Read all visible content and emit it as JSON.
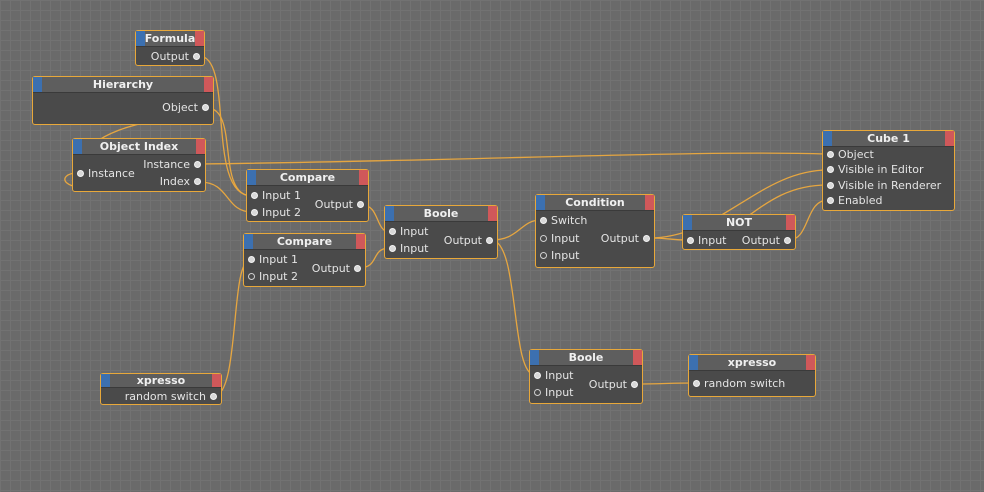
{
  "nodes": {
    "formula": {
      "title": "Formula",
      "output": "Output"
    },
    "hierarchy": {
      "title": "Hierarchy",
      "object": "Object"
    },
    "object_index": {
      "title": "Object Index",
      "instance_in": "Instance",
      "instance_out": "Instance",
      "index_out": "Index"
    },
    "compare1": {
      "title": "Compare",
      "input1": "Input 1",
      "input2": "Input 2",
      "output": "Output"
    },
    "compare2": {
      "title": "Compare",
      "input1": "Input 1",
      "input2": "Input 2",
      "output": "Output"
    },
    "boole1": {
      "title": "Boole",
      "input_a": "Input",
      "input_b": "Input",
      "output": "Output"
    },
    "condition": {
      "title": "Condition",
      "switch": "Switch",
      "input_a": "Input",
      "input_b": "Input",
      "output": "Output"
    },
    "not": {
      "title": "NOT",
      "input": "Input",
      "output": "Output"
    },
    "cube": {
      "title": "Cube 1",
      "object": "Object",
      "visible_editor": "Visible in Editor",
      "visible_renderer": "Visible in Renderer",
      "enabled": "Enabled"
    },
    "xpresso1": {
      "title": "xpresso",
      "output": "random switch"
    },
    "boole2": {
      "title": "Boole",
      "input_a": "Input",
      "input_b": "Input",
      "output": "Output"
    },
    "xpresso2": {
      "title": "xpresso",
      "input": "random switch"
    }
  },
  "colors": {
    "wire": "#e6a640",
    "node_border": "#e8a83a",
    "header_blue": "#3c70b0",
    "header_red": "#d0585a",
    "background": "#6a6a6a"
  }
}
